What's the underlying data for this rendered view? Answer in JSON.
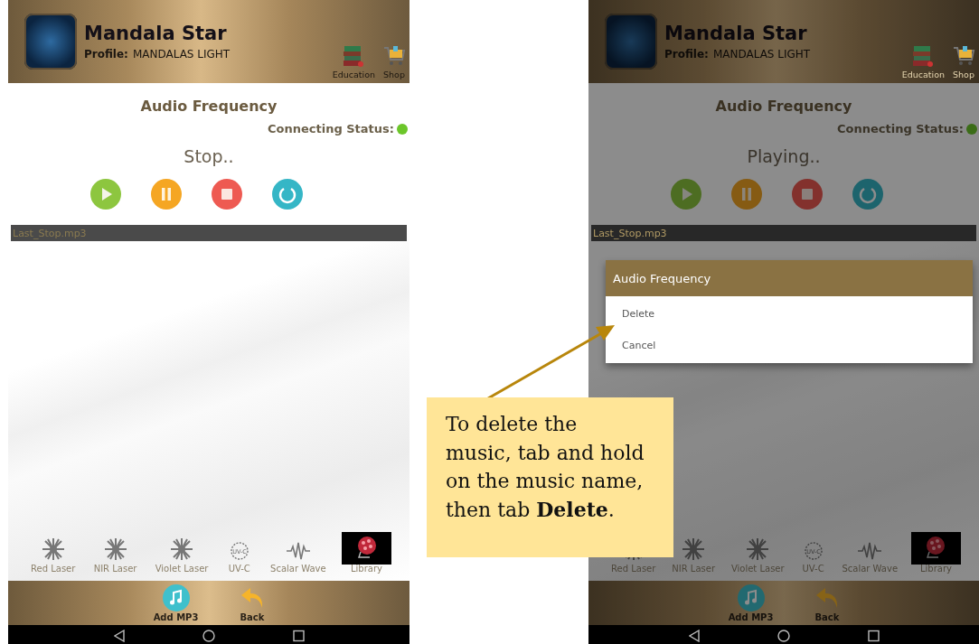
{
  "screens": [
    {
      "app_title": "Mandala Star",
      "profile_label": "Profile:",
      "profile_name": "MANDALAS LIGHT",
      "header_actions": [
        {
          "kind": "books",
          "label": "Education"
        },
        {
          "kind": "cart",
          "label": "Shop"
        }
      ],
      "page_title": "Audio Frequency",
      "connection_label": "Connecting Status:",
      "connected": true,
      "player_status": "Stop..",
      "controls": [
        {
          "kind": "play"
        },
        {
          "kind": "pause"
        },
        {
          "kind": "stop"
        },
        {
          "kind": "repeat"
        }
      ],
      "tracks": [
        {
          "name": "Last_Stop.mp3"
        }
      ],
      "modes": [
        {
          "kind": "laser",
          "label": "Red Laser",
          "selected": false
        },
        {
          "kind": "laser",
          "label": "NIR Laser",
          "selected": false
        },
        {
          "kind": "laser",
          "label": "Violet Laser",
          "selected": false
        },
        {
          "kind": "uvc",
          "badge": "UV-C",
          "label": "UV-C",
          "selected": false
        },
        {
          "kind": "wave",
          "label": "Scalar Wave",
          "selected": false
        },
        {
          "kind": "library",
          "label": "Library",
          "selected": true
        }
      ],
      "bottom_actions": [
        {
          "kind": "add_music",
          "label": "Add MP3"
        },
        {
          "kind": "back",
          "label": "Back"
        }
      ],
      "dimmed": false
    },
    {
      "app_title": "Mandala Star",
      "profile_label": "Profile:",
      "profile_name": "MANDALAS LIGHT",
      "header_actions": [
        {
          "kind": "books",
          "label": "Education"
        },
        {
          "kind": "cart",
          "label": "Shop"
        }
      ],
      "page_title": "Audio Frequency",
      "connection_label": "Connecting Status:",
      "connected": true,
      "player_status": "Playing..",
      "controls": [
        {
          "kind": "play"
        },
        {
          "kind": "pause"
        },
        {
          "kind": "stop"
        },
        {
          "kind": "repeat"
        }
      ],
      "tracks": [
        {
          "name": "Last_Stop.mp3"
        }
      ],
      "modes": [
        {
          "kind": "laser",
          "label": "Red Laser",
          "selected": false
        },
        {
          "kind": "laser",
          "label": "NIR Laser",
          "selected": false
        },
        {
          "kind": "laser",
          "label": "Violet Laser",
          "selected": false
        },
        {
          "kind": "uvc",
          "badge": "UV-C",
          "label": "UV-C",
          "selected": false
        },
        {
          "kind": "wave",
          "label": "Scalar Wave",
          "selected": false
        },
        {
          "kind": "library",
          "label": "Library",
          "selected": true
        }
      ],
      "bottom_actions": [
        {
          "kind": "add_music",
          "label": "Add MP3"
        },
        {
          "kind": "back",
          "label": "Back"
        }
      ],
      "dimmed": true,
      "dialog": {
        "title": "Audio Frequency",
        "options": [
          {
            "label": "Delete"
          },
          {
            "label": "Cancel"
          }
        ]
      }
    }
  ],
  "callout": {
    "text": "To delete the music, tab and hold on the music name, then tab **Delete**."
  }
}
